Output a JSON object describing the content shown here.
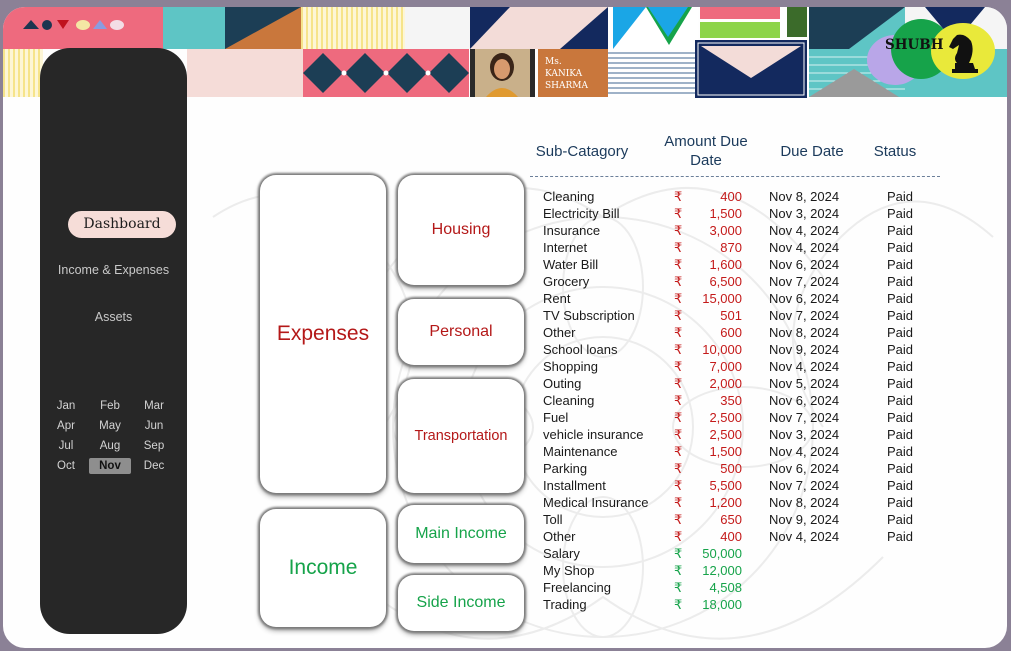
{
  "profile": {
    "title": "Ms.",
    "first_name": "KANIKA",
    "last_name": "SHARMA",
    "avatar": "person-photo"
  },
  "logo": {
    "text": "SHUBH",
    "icon": "chess-knight-icon"
  },
  "sidebar": {
    "nav": {
      "dashboard": "Dashboard",
      "income_expenses": "Income & Expenses",
      "assets": "Assets"
    },
    "months": [
      "Jan",
      "Feb",
      "Mar",
      "Apr",
      "May",
      "Jun",
      "Jul",
      "Aug",
      "Sep",
      "Oct",
      "Nov",
      "Dec"
    ],
    "selected_month": "Nov"
  },
  "categories": {
    "expenses": "Expenses",
    "income": "Income",
    "housing": "Housing",
    "personal": "Personal",
    "transportation": "Transportation",
    "main_income": "Main Income",
    "side_income": "Side Income"
  },
  "table": {
    "headers": {
      "subcategory": "Sub-Catagory",
      "amount_due": "Amount Due Date",
      "due_date": "Due Date",
      "status": "Status"
    },
    "currency": "₹",
    "rows": [
      {
        "sub": "Cleaning",
        "amount": "400",
        "date": "Nov 8, 2024",
        "status": "Paid",
        "type": "expense"
      },
      {
        "sub": "Electricity Bill",
        "amount": "1,500",
        "date": "Nov 3, 2024",
        "status": "Paid",
        "type": "expense"
      },
      {
        "sub": "Insurance",
        "amount": "3,000",
        "date": "Nov 4, 2024",
        "status": "Paid",
        "type": "expense"
      },
      {
        "sub": "Internet",
        "amount": "870",
        "date": "Nov 4, 2024",
        "status": "Paid",
        "type": "expense"
      },
      {
        "sub": "Water Bill",
        "amount": "1,600",
        "date": "Nov 6, 2024",
        "status": "Paid",
        "type": "expense"
      },
      {
        "sub": "Grocery",
        "amount": "6,500",
        "date": "Nov 7, 2024",
        "status": "Paid",
        "type": "expense"
      },
      {
        "sub": "Rent",
        "amount": "15,000",
        "date": "Nov 6, 2024",
        "status": "Paid",
        "type": "expense"
      },
      {
        "sub": "TV Subscription",
        "amount": "501",
        "date": "Nov 7, 2024",
        "status": "Paid",
        "type": "expense"
      },
      {
        "sub": "Other",
        "amount": "600",
        "date": "Nov 8, 2024",
        "status": "Paid",
        "type": "expense"
      },
      {
        "sub": "School loans",
        "amount": "10,000",
        "date": "Nov 9, 2024",
        "status": "Paid",
        "type": "expense"
      },
      {
        "sub": "Shopping",
        "amount": "7,000",
        "date": "Nov 4, 2024",
        "status": "Paid",
        "type": "expense"
      },
      {
        "sub": "Outing",
        "amount": "2,000",
        "date": "Nov 5, 2024",
        "status": "Paid",
        "type": "expense"
      },
      {
        "sub": "Cleaning",
        "amount": "350",
        "date": "Nov 6, 2024",
        "status": "Paid",
        "type": "expense"
      },
      {
        "sub": "Fuel",
        "amount": "2,500",
        "date": "Nov 7, 2024",
        "status": "Paid",
        "type": "expense"
      },
      {
        "sub": "vehicle insurance",
        "amount": "2,500",
        "date": "Nov 3, 2024",
        "status": "Paid",
        "type": "expense"
      },
      {
        "sub": "Maintenance",
        "amount": "1,500",
        "date": "Nov 4, 2024",
        "status": "Paid",
        "type": "expense"
      },
      {
        "sub": "Parking",
        "amount": "500",
        "date": "Nov 6, 2024",
        "status": "Paid",
        "type": "expense"
      },
      {
        "sub": "Installment",
        "amount": "5,500",
        "date": "Nov 7, 2024",
        "status": "Paid",
        "type": "expense"
      },
      {
        "sub": "Medical Insurance",
        "amount": "1,200",
        "date": "Nov 8, 2024",
        "status": "Paid",
        "type": "expense"
      },
      {
        "sub": "Toll",
        "amount": "650",
        "date": "Nov 9, 2024",
        "status": "Paid",
        "type": "expense"
      },
      {
        "sub": "Other",
        "amount": "400",
        "date": "Nov 4, 2024",
        "status": "Paid",
        "type": "expense"
      },
      {
        "sub": "Salary",
        "amount": "50,000",
        "date": "",
        "status": "",
        "type": "income"
      },
      {
        "sub": "My Shop",
        "amount": "12,000",
        "date": "",
        "status": "",
        "type": "income"
      },
      {
        "sub": "Freelancing",
        "amount": "4,508",
        "date": "",
        "status": "",
        "type": "income"
      },
      {
        "sub": "Trading",
        "amount": "18,000",
        "date": "",
        "status": "",
        "type": "income"
      }
    ]
  },
  "colors": {
    "expense": "#c41a1a",
    "income": "#16a34a",
    "sidebar": "#272727",
    "active_nav": "#f6ddd8",
    "header_text": "#1b3a5b"
  }
}
